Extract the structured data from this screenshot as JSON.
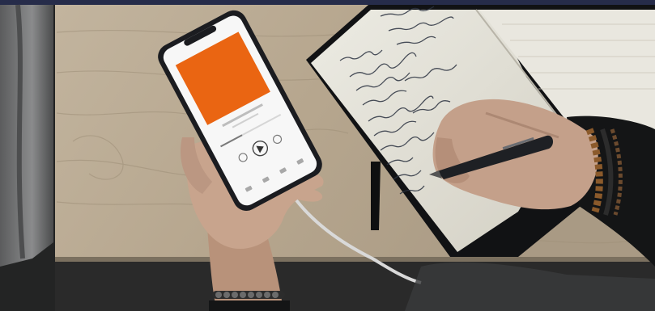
{
  "scene": {
    "colors": {
      "top_band": "#262c4a",
      "room_dark": "#232424",
      "left_curtain": "#6e6f70",
      "table_wood": "#b9ab95",
      "table_shadow": "#2a2a2a",
      "phone_body": "#1b1c20",
      "phone_screen": "#f7f7f7",
      "album_art": "#ea6512",
      "notebook_page": "#e4e1d6",
      "notebook_cover": "#111214",
      "ink": "#2b3240",
      "skin": "#c8a48d",
      "skin_shadow": "#9d7864",
      "pen": "#1e2024",
      "bead_bracelet": "#8b5a2b",
      "cable": "#d9d9d9"
    }
  }
}
